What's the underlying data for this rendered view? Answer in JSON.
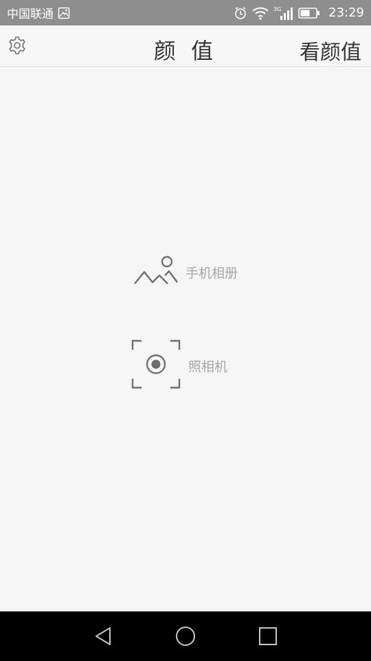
{
  "status_bar": {
    "carrier": "中国联通",
    "network": "3G",
    "time": "23:29",
    "icons": [
      "image-icon",
      "alarm-icon",
      "wifi-icon",
      "signal-icon",
      "battery-icon"
    ]
  },
  "header": {
    "title": "颜 值",
    "action_label": "看颜值",
    "settings_icon": "gear-icon"
  },
  "options": {
    "album": {
      "label": "手机相册",
      "icon": "gallery-icon"
    },
    "camera": {
      "label": "照相机",
      "icon": "camera-icon"
    }
  },
  "nav": {
    "back_icon": "back-icon",
    "home_icon": "home-icon",
    "recent_icon": "recent-apps-icon"
  },
  "colors": {
    "status_bar": "#8e8e8e",
    "header_bg": "#f7f7f7",
    "body_bg": "#f5f5f5",
    "title_text": "#333333",
    "option_text": "#a7a7a7",
    "icon_gray": "#6e6e6e",
    "nav_bg": "#000000"
  }
}
